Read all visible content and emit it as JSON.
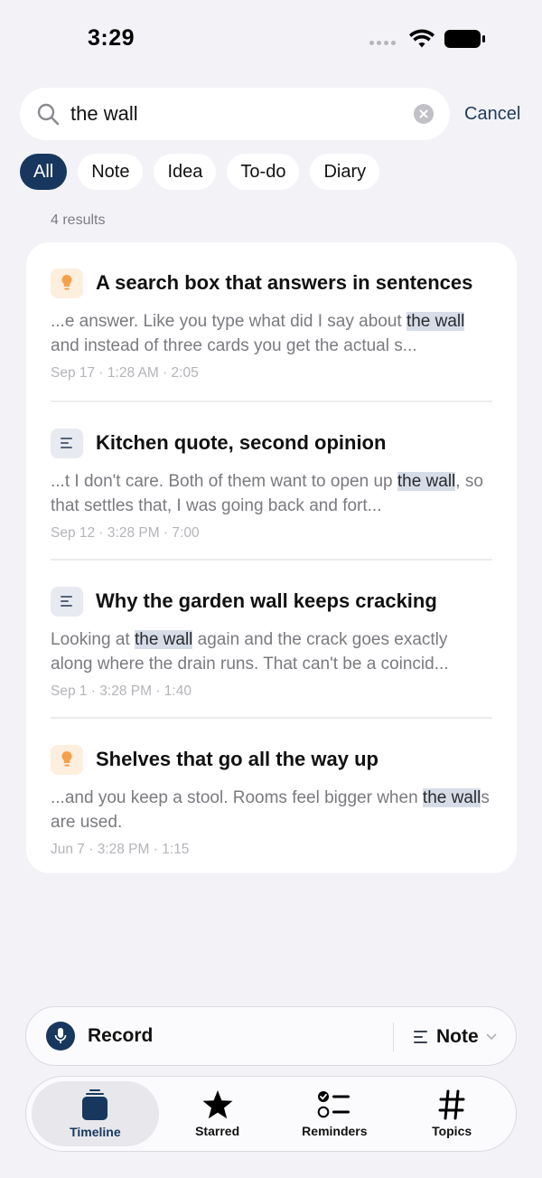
{
  "status": {
    "time": "3:29"
  },
  "search": {
    "query": "the wall",
    "placeholder": "Search",
    "cancel_label": "Cancel"
  },
  "filters": [
    {
      "label": "All",
      "active": true
    },
    {
      "label": "Note",
      "active": false
    },
    {
      "label": "Idea",
      "active": false
    },
    {
      "label": "To-do",
      "active": false
    },
    {
      "label": "Diary",
      "active": false
    }
  ],
  "results_count": "4 results",
  "results": [
    {
      "type": "idea",
      "title": "A search box that answers in sentences",
      "snippet_before": "...e answer. Like you type what did I say about ",
      "snippet_match": "the wall",
      "snippet_after": " and instead of three cards you get the actual s...",
      "meta": "Sep 17 · 1:28 AM · 2:05"
    },
    {
      "type": "note",
      "title": "Kitchen quote, second opinion",
      "snippet_before": "...t I don't care. Both of them want to open up ",
      "snippet_match": "the wall",
      "snippet_after": ", so that settles that, I was going back and fort...",
      "meta": "Sep 12 · 3:28 PM · 7:00"
    },
    {
      "type": "note",
      "title": "Why the garden wall keeps cracking",
      "snippet_before": "Looking at ",
      "snippet_match": "the wall",
      "snippet_after": " again and the crack goes exactly along where the drain runs. That can't be a coincid...",
      "meta": "Sep 1 · 3:28 PM · 1:40"
    },
    {
      "type": "idea",
      "title": "Shelves that go all the way up",
      "snippet_before": "...and you keep a stool. Rooms feel bigger when ",
      "snippet_match": "the wall",
      "snippet_after": "s are used.",
      "meta": "Jun 7 · 3:28 PM · 1:15"
    }
  ],
  "record_bar": {
    "record_label": "Record",
    "note_label": "Note"
  },
  "tabs": [
    {
      "label": "Timeline",
      "icon": "timeline-icon",
      "active": true
    },
    {
      "label": "Starred",
      "icon": "star-icon",
      "active": false
    },
    {
      "label": "Reminders",
      "icon": "reminders-icon",
      "active": false
    },
    {
      "label": "Topics",
      "icon": "hashtag-icon",
      "active": false
    }
  ],
  "colors": {
    "accent": "#17375e",
    "highlight": "#d6dde8",
    "idea_bg": "#fdeede",
    "idea_icon": "#f5a04a",
    "note_bg": "#e7eaf0"
  }
}
